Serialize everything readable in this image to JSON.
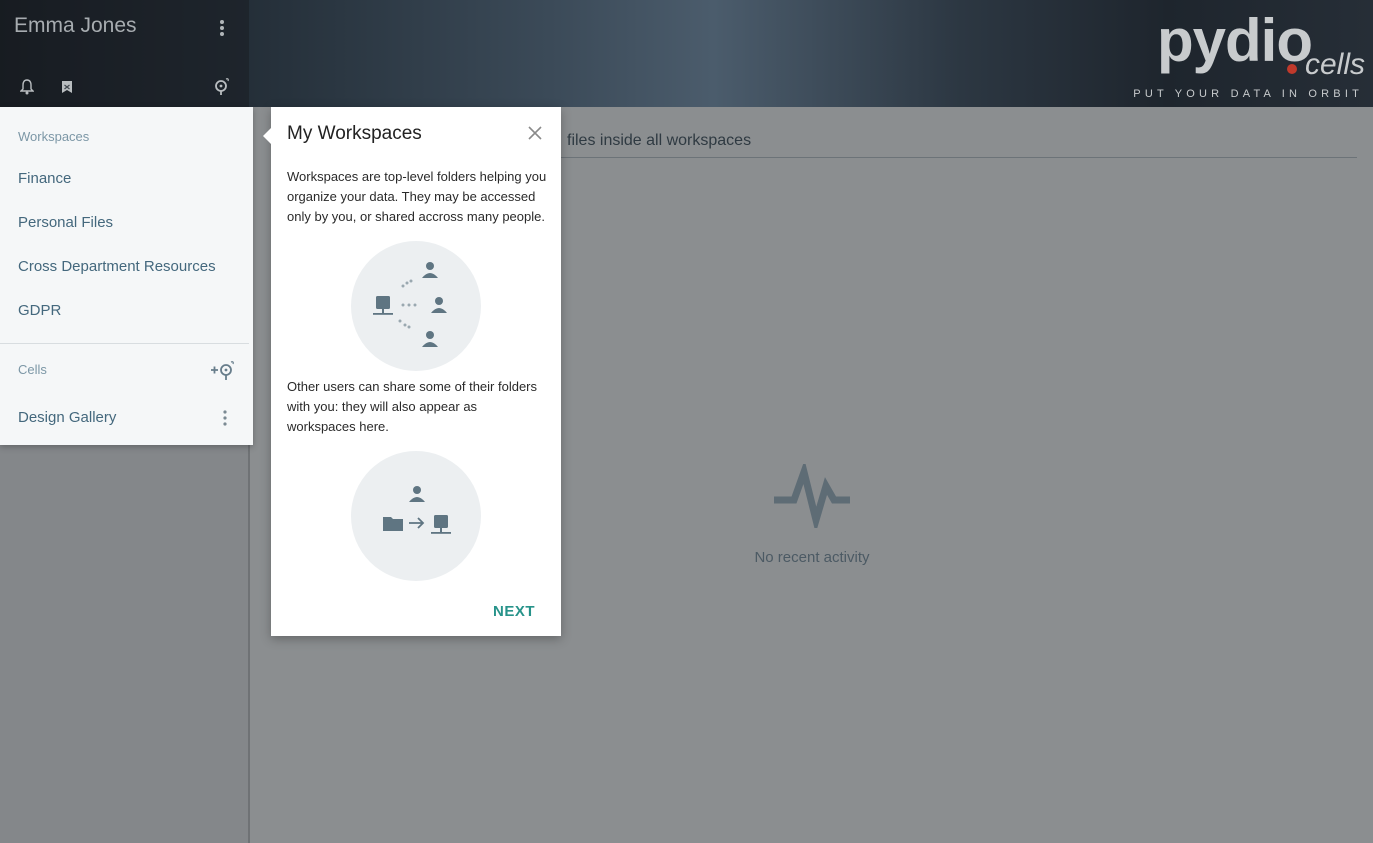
{
  "header": {
    "user_name": "Emma Jones",
    "logo_text": "pydio",
    "logo_sub": "cells",
    "tagline": "PUT YOUR DATA IN ORBIT",
    "icons": [
      "menu-dots-icon",
      "bell-icon",
      "bookmark-icon",
      "cells-icon"
    ]
  },
  "sidebar": {
    "workspaces_title": "Workspaces",
    "workspaces": [
      {
        "label": "Finance"
      },
      {
        "label": "Personal Files"
      },
      {
        "label": "Cross Department Resources"
      },
      {
        "label": "GDPR"
      }
    ],
    "cells_title": "Cells",
    "cells_add_label": "+",
    "cells": [
      {
        "label": "Design Gallery"
      }
    ]
  },
  "main": {
    "search_text": "files inside all workspaces",
    "empty_label": "No recent activity"
  },
  "popup": {
    "title": "My Workspaces",
    "text1": "Workspaces are top-level folders helping you organize your data. They may be accessed only by you, or shared accross many people.",
    "text2": "Other users can share some of their folders with you: they will also appear as workspaces here.",
    "next_label": "NEXT"
  },
  "colors": {
    "accent": "#27938a",
    "link": "#44687d",
    "section": "#7c97a6"
  }
}
